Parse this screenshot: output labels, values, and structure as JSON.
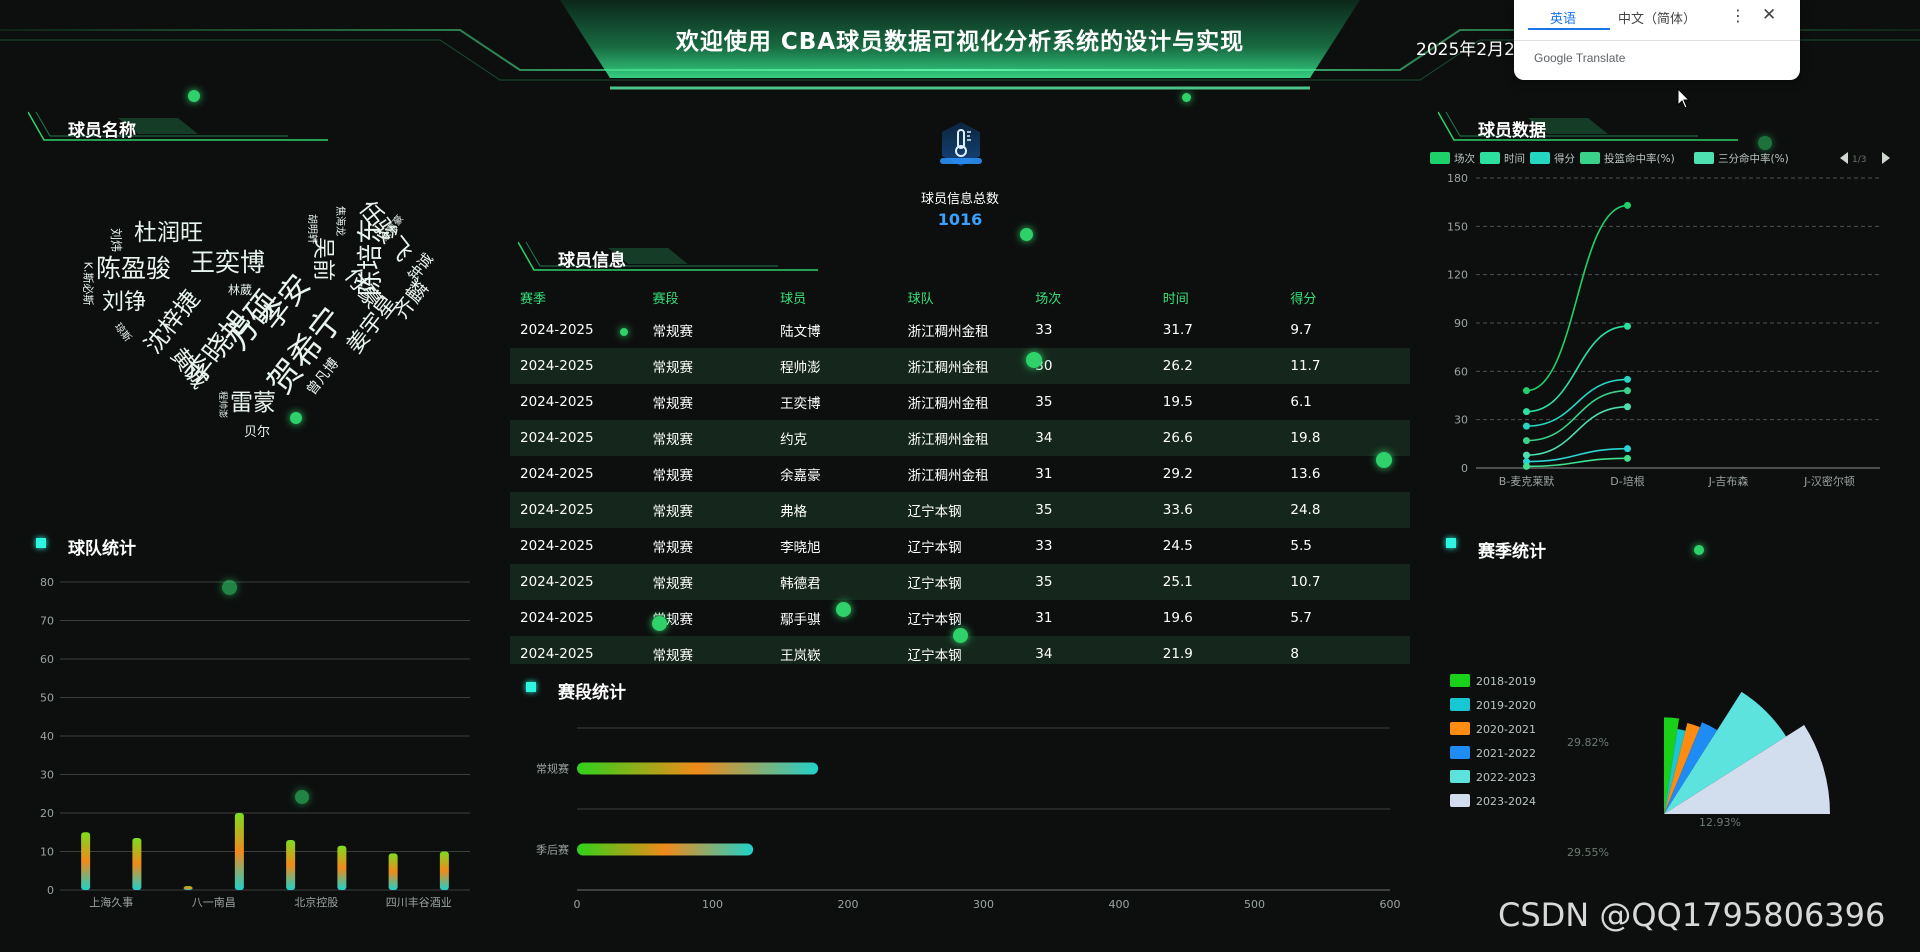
{
  "header": {
    "title": "欢迎使用 CBA球员数据可视化分析系统的设计与实现",
    "datetime": "2025年2月26"
  },
  "translate_popup": {
    "tab_source": "英语",
    "tab_target": "中文（简体）",
    "brand": "Google Translate",
    "more_icon": "more-vert-icon",
    "close_icon": "close-icon"
  },
  "sections": {
    "player_names": "球员名称",
    "team_stats": "球队统计",
    "player_info": "球员信息",
    "stage_stats": "赛段统计",
    "player_data": "球员数据",
    "season_stats": "赛季统计"
  },
  "word_cloud": [
    {
      "text": "杜润旺",
      "color": "#8fd6c8"
    },
    {
      "text": "陈盈骏",
      "color": "#9a8fe8"
    },
    {
      "text": "王奕博",
      "color": "#e8e0c8"
    },
    {
      "text": "刘铮",
      "color": "#e9b96e"
    },
    {
      "text": "沈梓捷",
      "color": "#8fd6c8"
    },
    {
      "text": "李晓旭",
      "color": "#a68be8"
    },
    {
      "text": "方硕",
      "color": "#a68be8"
    },
    {
      "text": "李安",
      "color": "#e9b96e"
    },
    {
      "text": "贺希宁",
      "color": "#8fd6c8"
    },
    {
      "text": "陈培东",
      "color": "#5ed8d0"
    },
    {
      "text": "任骏飞",
      "color": "#e8e0c8"
    },
    {
      "text": "付豪",
      "color": "#e8e0c8"
    },
    {
      "text": "吴前",
      "color": "#e9b96e"
    },
    {
      "text": "姜宇星",
      "color": "#a68be8"
    },
    {
      "text": "齐麟",
      "color": "#e9d58e"
    },
    {
      "text": "黄诚",
      "color": "#8fd6c8"
    },
    {
      "text": "雷蒙",
      "color": "#e9b96e"
    },
    {
      "text": "林葳",
      "color": "#e8e0c8"
    },
    {
      "text": "钟诚",
      "color": "#e9d58e"
    },
    {
      "text": "贝尔",
      "color": "#cfd8d0"
    },
    {
      "text": "刘炜",
      "color": "#cfd8d0"
    },
    {
      "text": "K.斯必斯",
      "color": "#cfd8d0"
    },
    {
      "text": "曾凡博",
      "color": "#8fd6c8"
    },
    {
      "text": "琼斯",
      "color": "#cfd8d0"
    },
    {
      "text": "胡明轩",
      "color": "#cfd8d0"
    },
    {
      "text": "余嘉豪",
      "color": "#e9d58e"
    },
    {
      "text": "焦海龙",
      "color": "#cfd8d0"
    },
    {
      "text": "程帅澎",
      "color": "#cfd8d0"
    }
  ],
  "summary": {
    "label": "球员信息总数",
    "value": "1016",
    "icon": "thermometer-icon"
  },
  "table": {
    "headers": [
      "赛季",
      "赛段",
      "球员",
      "球队",
      "场次",
      "时间",
      "得分"
    ],
    "rows": [
      [
        "2024-2025",
        "常规赛",
        "陆文博",
        "浙江稠州金租",
        "33",
        "31.7",
        "9.7"
      ],
      [
        "2024-2025",
        "常规赛",
        "程帅澎",
        "浙江稠州金租",
        "30",
        "26.2",
        "11.7"
      ],
      [
        "2024-2025",
        "常规赛",
        "王奕博",
        "浙江稠州金租",
        "35",
        "19.5",
        "6.1"
      ],
      [
        "2024-2025",
        "常规赛",
        "约克",
        "浙江稠州金租",
        "34",
        "26.6",
        "19.8"
      ],
      [
        "2024-2025",
        "常规赛",
        "余嘉豪",
        "浙江稠州金租",
        "31",
        "29.2",
        "13.6"
      ],
      [
        "2024-2025",
        "常规赛",
        "弗格",
        "辽宁本钢",
        "35",
        "33.6",
        "24.8"
      ],
      [
        "2024-2025",
        "常规赛",
        "李晓旭",
        "辽宁本钢",
        "33",
        "24.5",
        "5.5"
      ],
      [
        "2024-2025",
        "常规赛",
        "韩德君",
        "辽宁本钢",
        "35",
        "25.1",
        "10.7"
      ],
      [
        "2024-2025",
        "常规赛",
        "鄢手骐",
        "辽宁本钢",
        "31",
        "19.6",
        "5.7"
      ],
      [
        "2024-2025",
        "常规赛",
        "王岚嵚",
        "辽宁本钢",
        "34",
        "21.9",
        "8"
      ]
    ]
  },
  "colors": {
    "accent_green": "#36e07a",
    "accent_cyan": "#2ef5e0",
    "background": "#0d0f0e",
    "summary_value": "#3aa1ff"
  },
  "chart_data": [
    {
      "id": "team",
      "type": "bar",
      "title": "球队统计",
      "categories": [
        "上海久事",
        "八一南昌",
        "北京控股",
        "四川丰谷酒业",
        "",
        "",
        "",
        ""
      ],
      "tick_labels": [
        "上海久事",
        "八一南昌",
        "北京控股",
        "四川丰谷酒业"
      ],
      "values": [
        15,
        13.5,
        1,
        20,
        13,
        11.5,
        9.5,
        10
      ],
      "ylim": [
        0,
        80
      ],
      "yticks": [
        0,
        10,
        20,
        30,
        40,
        50,
        60,
        70,
        80
      ],
      "grid": true
    },
    {
      "id": "stage",
      "type": "bar",
      "orientation": "horizontal",
      "title": "赛段统计",
      "categories": [
        "常规赛",
        "季后赛"
      ],
      "values": [
        178,
        130
      ],
      "xlim": [
        0,
        600
      ],
      "xticks": [
        0,
        100,
        200,
        300,
        400,
        500,
        600
      ]
    },
    {
      "id": "player",
      "type": "line",
      "title": "球员数据",
      "categories": [
        "B-麦克莱默",
        "D-培根",
        "J-吉布森",
        "J-汉密尔顿"
      ],
      "legend": [
        "场次",
        "时间",
        "得分",
        "投篮命中率(%)",
        "三分命中率(%)"
      ],
      "legend_page": "1/3",
      "legend_position": "top",
      "series": [
        {
          "name": "场次",
          "values": [
            48,
            163
          ]
        },
        {
          "name": "时间",
          "values": [
            35,
            88
          ]
        },
        {
          "name": "得分",
          "values": [
            26,
            55
          ]
        },
        {
          "name": "投篮命中率(%)",
          "values": [
            17,
            48
          ]
        },
        {
          "name": "三分命中率(%)",
          "values": [
            8,
            38
          ]
        },
        {
          "name": "",
          "values": [
            4,
            12
          ]
        },
        {
          "name": "",
          "values": [
            1,
            6
          ]
        }
      ],
      "ylim": [
        0,
        180
      ],
      "yticks": [
        0,
        30,
        60,
        90,
        120,
        150,
        180
      ],
      "grid": true
    },
    {
      "id": "season",
      "type": "pie",
      "title": "赛季统计",
      "labels": [
        "2018-2019",
        "2019-2020",
        "2020-2021",
        "2021-2022",
        "2022-2023",
        "2023-2024"
      ],
      "values": [
        5,
        3,
        4.5,
        5.5,
        14,
        18
      ],
      "colors": [
        "#1ad11a",
        "#17c8d4",
        "#ff8c12",
        "#1f8bf5",
        "#5de3de",
        "#d2deed"
      ],
      "visible_labels": [
        "29.82%",
        "29.55%",
        "12.93%"
      ],
      "legend_position": "left"
    }
  ]
}
